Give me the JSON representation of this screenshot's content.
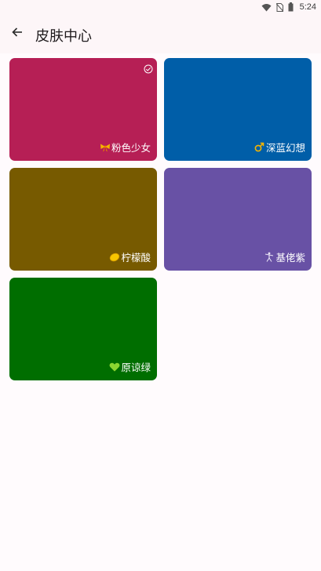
{
  "status_bar": {
    "time": "5:24",
    "icons": [
      "wifi-icon",
      "no-sim-icon",
      "battery-icon"
    ]
  },
  "app_bar": {
    "back_icon": "arrow-left-icon",
    "title": "皮肤中心"
  },
  "skins": [
    {
      "name": "粉色少女",
      "color": "#b61f55",
      "icon": "bow-icon",
      "selected": true
    },
    {
      "name": "深蓝幻想",
      "color": "#005ea8",
      "icon": "male-sign-icon",
      "selected": false
    },
    {
      "name": "柠檬酸",
      "color": "#775a00",
      "icon": "lemon-icon",
      "selected": false
    },
    {
      "name": "基佬紫",
      "color": "#6851a5",
      "icon": "dancer-icon",
      "selected": false
    },
    {
      "name": "原谅绿",
      "color": "#006e00",
      "icon": "green-heart-icon",
      "selected": false
    }
  ]
}
